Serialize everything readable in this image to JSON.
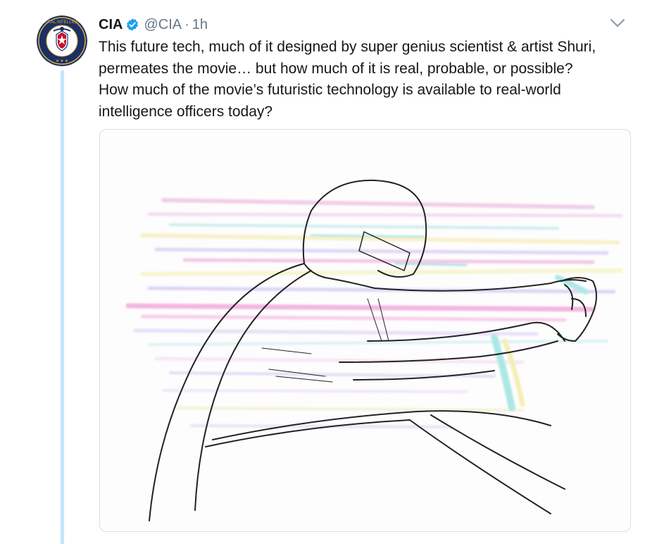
{
  "tweet": {
    "author_name": "CIA",
    "handle": "@CIA",
    "separator": "·",
    "timestamp": "1h",
    "text": "This future tech, much of it designed by super genius scientist & artist Shuri,\npermeates the movie… but how much of it is real, probable, or possible?\nHow much of the movie’s futuristic technology is available to real-world\nintelligence officers today?"
  },
  "colors": {
    "verified": "#1da1f2",
    "thread_line": "#c4e4fb",
    "muted_text": "#657786",
    "seal_blue": "#1b2f66"
  },
  "icons": [
    "cia-seal-icon",
    "verified-badge-icon",
    "chevron-down-icon"
  ]
}
